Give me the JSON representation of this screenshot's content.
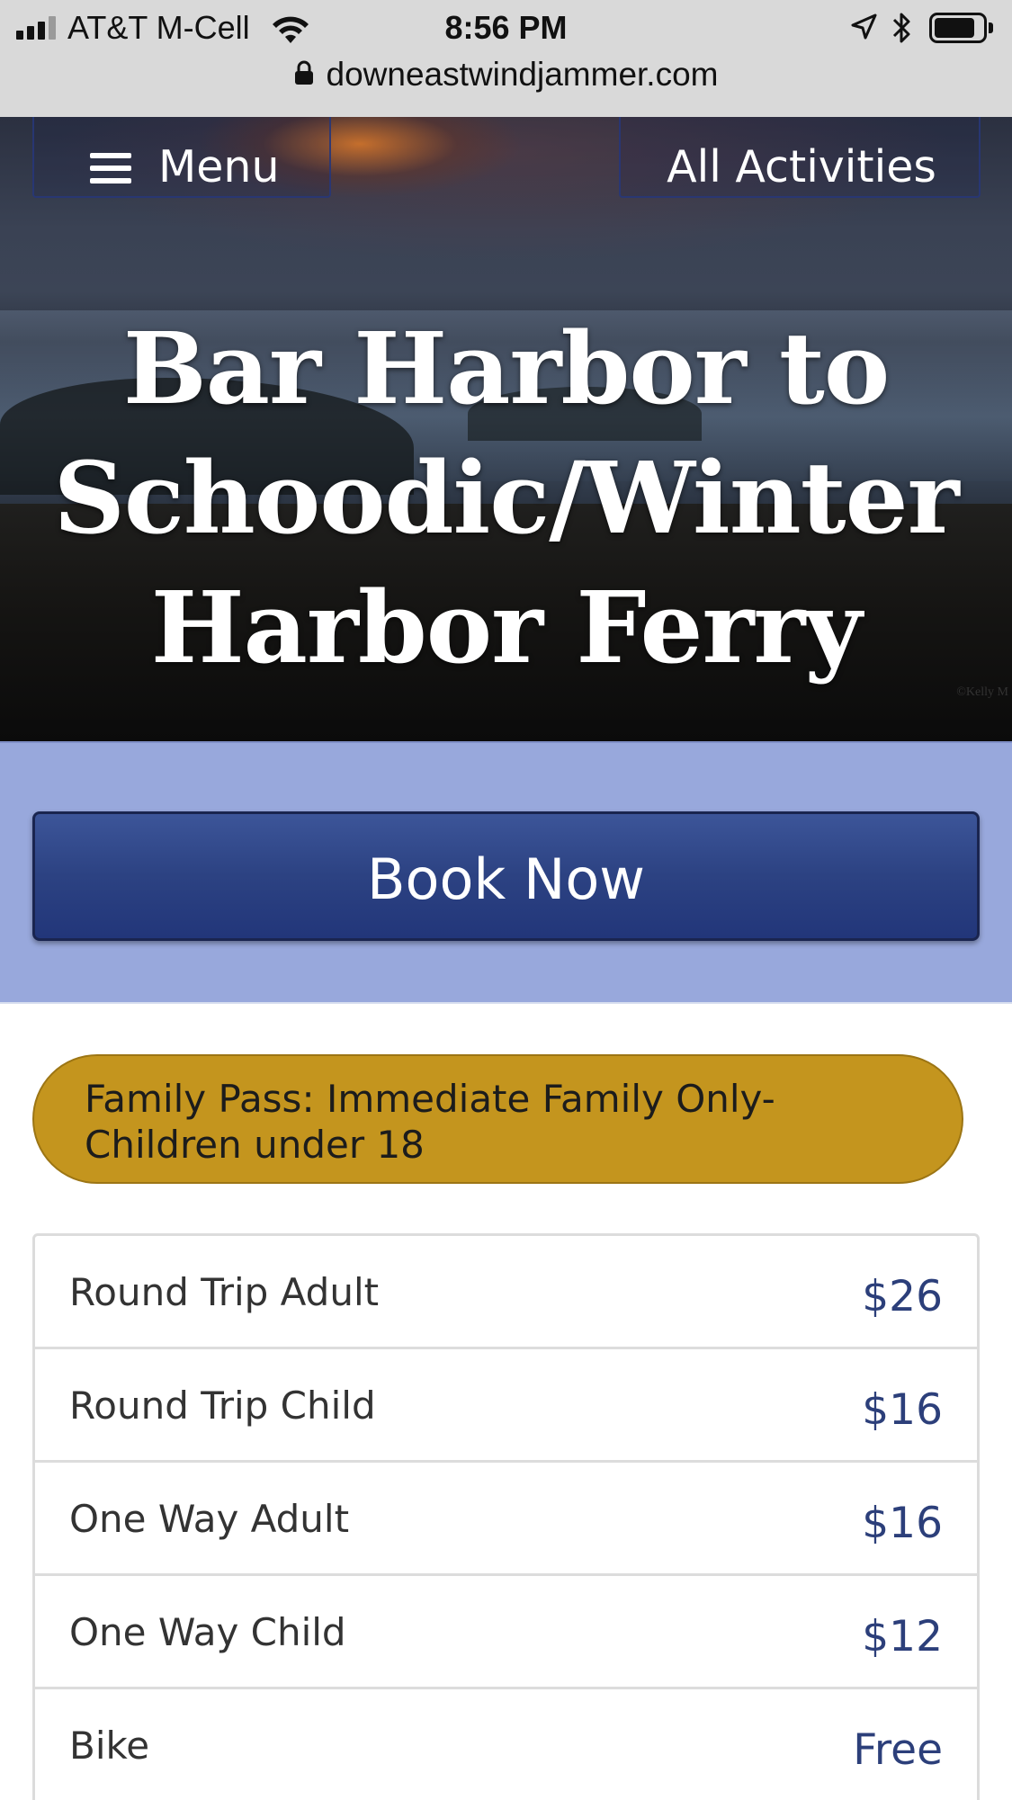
{
  "status_bar": {
    "carrier": "AT&T M-Cell",
    "time": "8:56 PM",
    "url": "downeastwindjammer.com",
    "icons": [
      "signal-icon",
      "wifi-icon",
      "location-icon",
      "bluetooth-icon",
      "battery-icon",
      "lock-icon"
    ]
  },
  "nav": {
    "menu_label": "Menu",
    "all_activities_label": "All Activities"
  },
  "hero": {
    "title": "Bar Harbor to Schoodic/Winter Harbor Ferry",
    "watermark": "©Kelly M"
  },
  "book": {
    "label": "Book Now"
  },
  "family_pass": {
    "text": "Family Pass: Immediate Family Only-Children under 18"
  },
  "prices": [
    {
      "label": "Round Trip Adult",
      "value": "$26"
    },
    {
      "label": "Round Trip Child",
      "value": "$16"
    },
    {
      "label": "One Way Adult",
      "value": "$16"
    },
    {
      "label": "One Way Child",
      "value": "$12"
    },
    {
      "label": "Bike",
      "value": "Free"
    }
  ],
  "colors": {
    "status_bar_bg": "#d9d9d9",
    "book_band_bg": "#98a8dc",
    "book_button": "#2c4282",
    "family_pass_pill": "#c4951e",
    "price_text": "#2c3f7a"
  }
}
